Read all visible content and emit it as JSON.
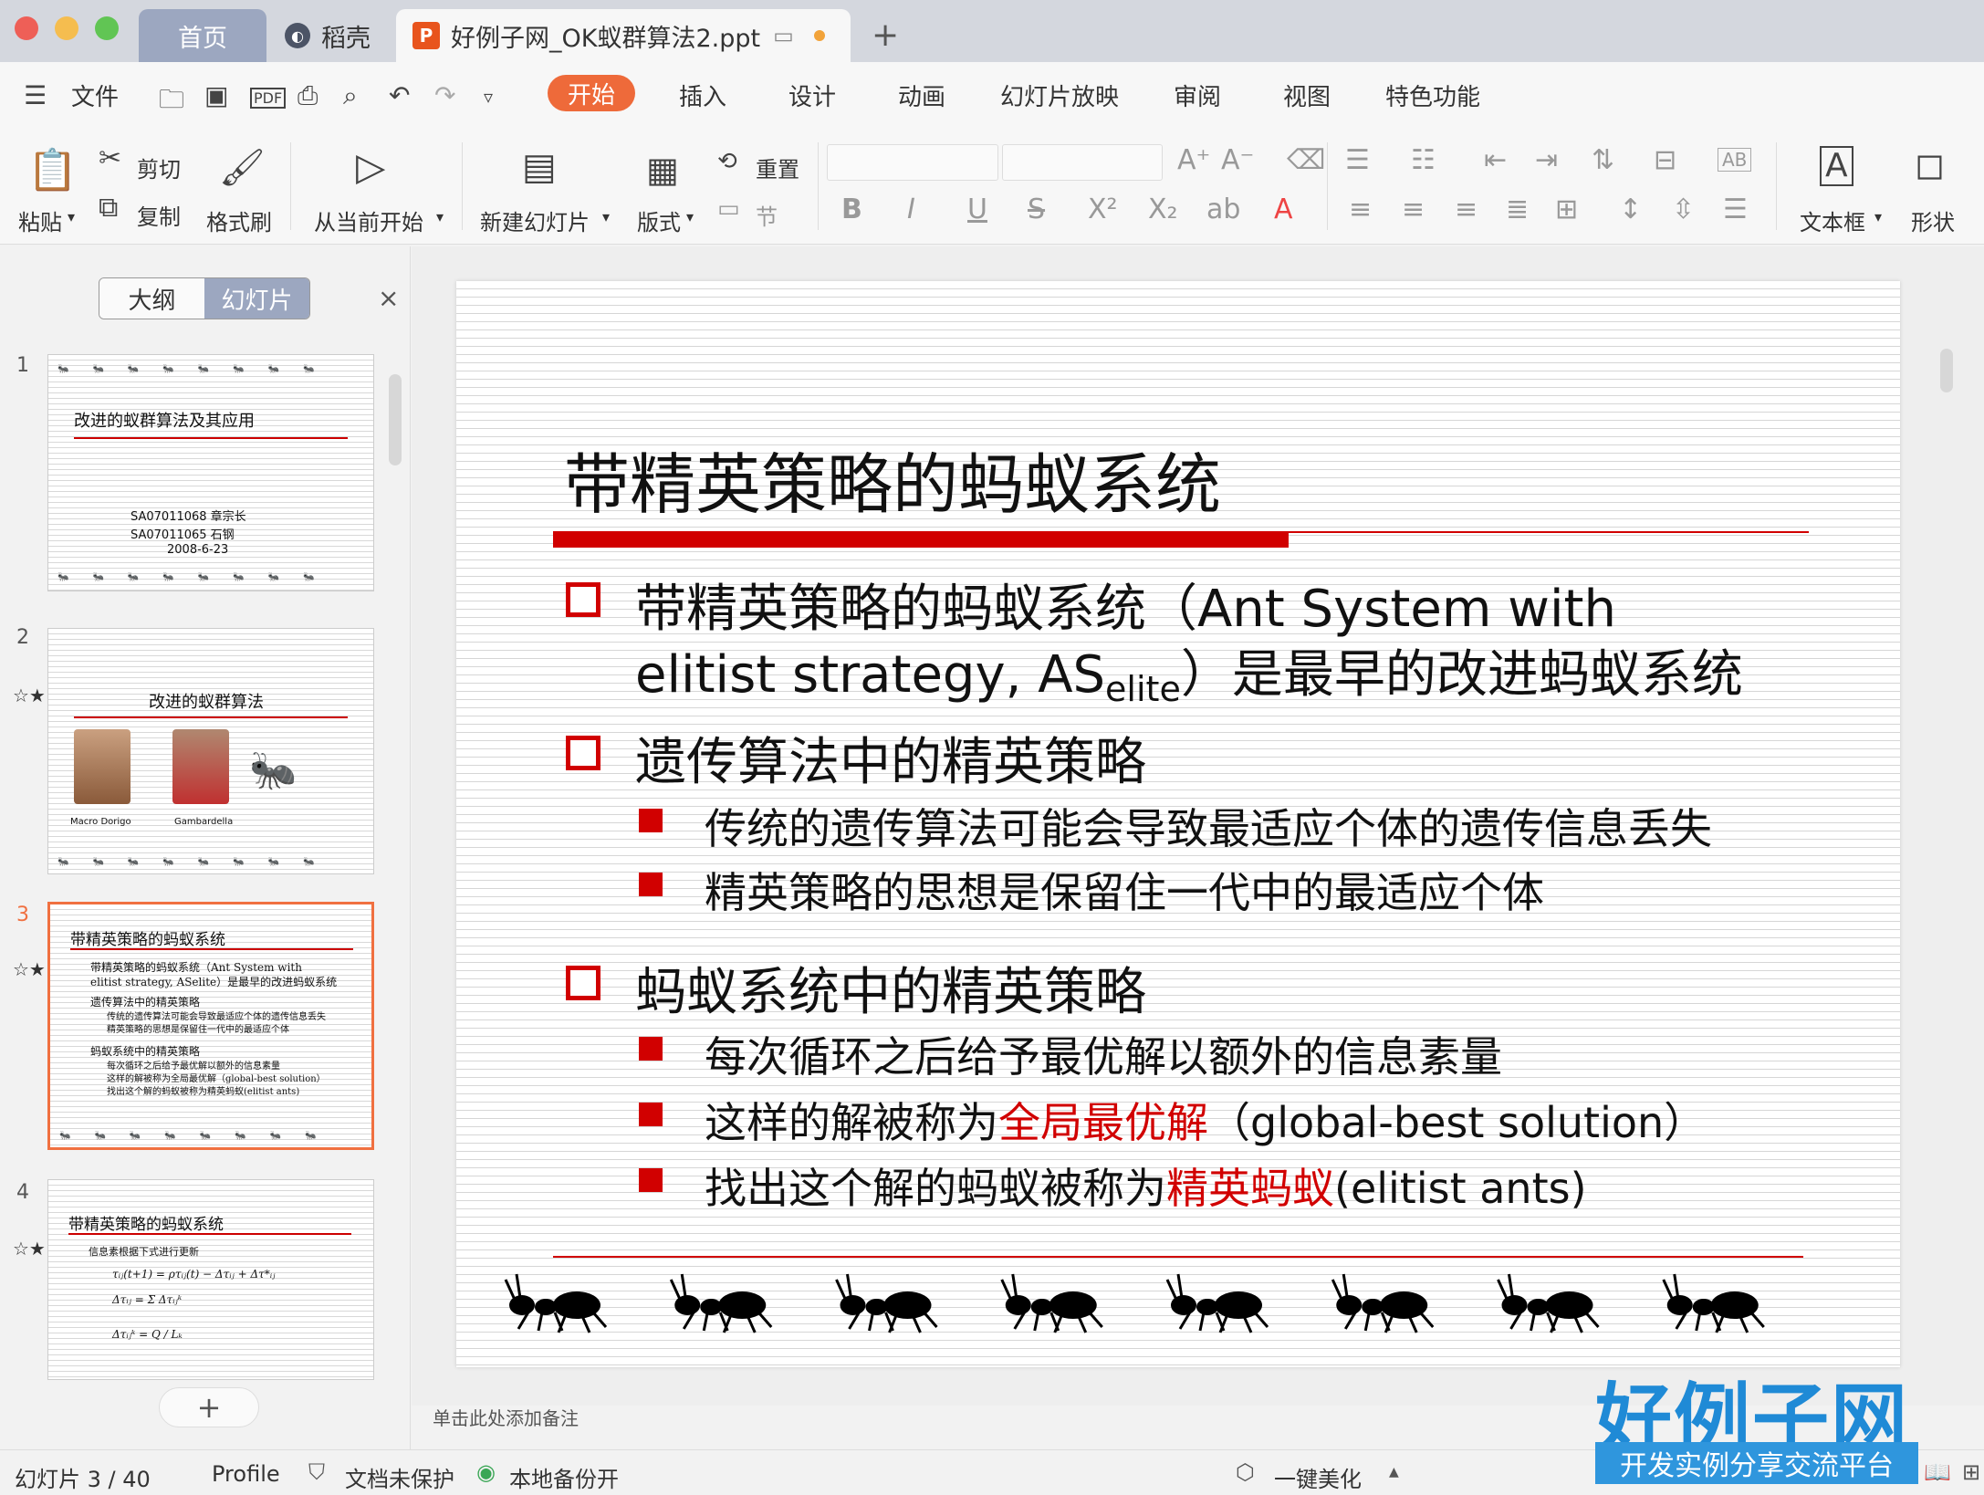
{
  "titlebar": {
    "tabs": [
      {
        "label": "首页"
      },
      {
        "label": "稻壳"
      },
      {
        "label": "好例子网_OK蚁群算法2.ppt",
        "icon": "P"
      }
    ],
    "new_tab": "+"
  },
  "menu": {
    "file": "文件",
    "items": [
      "开始",
      "插入",
      "设计",
      "动画",
      "幻灯片放映",
      "审阅",
      "视图",
      "特色功能"
    ],
    "active": "开始"
  },
  "ribbon": {
    "paste": "粘贴",
    "cut": "剪切",
    "copy": "复制",
    "format_painter": "格式刷",
    "from_current": "从当前开始",
    "new_slide": "新建幻灯片",
    "layout": "版式",
    "reset": "重置",
    "section": "节",
    "textbox": "文本框",
    "shape": "形状"
  },
  "panel": {
    "outline_tab": "大纲",
    "slides_tab": "幻灯片",
    "close": "×",
    "add": "+"
  },
  "thumbnails": [
    {
      "num": "1",
      "title": "改进的蚁群算法及其应用",
      "lines": [
        "SA07011068    章宗长",
        "SA07011065        石钢",
        "2008-6-23"
      ]
    },
    {
      "num": "2",
      "title": "改进的蚁群算法",
      "captions": [
        "Macro Dorigo",
        "Gambardella"
      ]
    },
    {
      "num": "3",
      "title": "带精英策略的蚂蚁系统",
      "lines": [
        "带精英策略的蚂蚁系统（Ant System with",
        "elitist strategy, ASelite）是最早的改进蚂蚁系统",
        "遗传算法中的精英策略",
        "传统的遗传算法可能会导致最适应个体的遗传信息丢失",
        "精英策略的思想是保留住一代中的最适应个体",
        "蚂蚁系统中的精英策略",
        "每次循环之后给予最优解以额外的信息素量",
        "这样的解被称为全局最优解（global-best solution）",
        "找出这个解的蚂蚁被称为精英蚂蚁(elitist ants)"
      ]
    },
    {
      "num": "4",
      "title": "带精英策略的蚂蚁系统",
      "lines": [
        "信息素根据下式进行更新"
      ]
    }
  ],
  "slide": {
    "title": "带精英策略的蚂蚁系统",
    "b1_line1": "带精英策略的蚂蚁系统（Ant System with",
    "b1_line2a": "elitist strategy, AS",
    "b1_line2sub": "elite",
    "b1_line2b": "）是最早的改进蚂蚁系统",
    "b2": "遗传算法中的精英策略",
    "b2_s1": "传统的遗传算法可能会导致最适应个体的遗传信息丢失",
    "b2_s2": "精英策略的思想是保留住一代中的最适应个体",
    "b3": "蚂蚁系统中的精英策略",
    "b3_s1": "每次循环之后给予最优解以额外的信息素量",
    "b3_s2a": "这样的解被称为",
    "b3_s2red": "全局最优解",
    "b3_s2b": "（global-best solution）",
    "b3_s3a": "找出这个解的蚂蚁被称为",
    "b3_s3red": "精英蚂蚁",
    "b3_s3b": "(elitist ants)",
    "ant_count": 8
  },
  "notes_hint": "单击此处添加备注",
  "status": {
    "slide_counter": "幻灯片 3 / 40",
    "profile": "Profile",
    "unprotected": "文档未保护",
    "backup": "本地备份开",
    "beautify": "一键美化"
  },
  "brand": {
    "name": "好例子网",
    "slogan": "开发实例分享交流平台"
  },
  "colors": {
    "accent_red": "#d10000",
    "tab_active": "#ee6a3a",
    "selected_thumb": "#f07040",
    "brand_blue": "#1f8ad6"
  }
}
